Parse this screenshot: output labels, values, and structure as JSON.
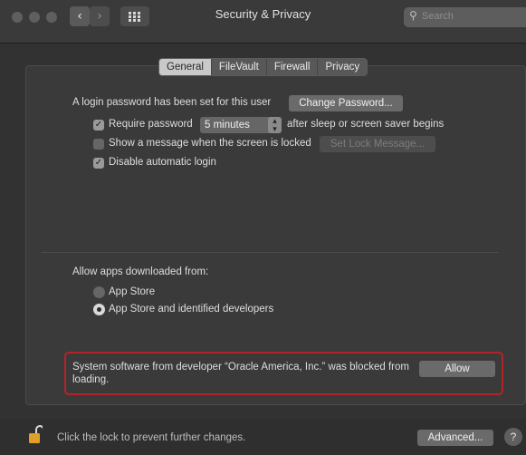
{
  "window": {
    "title": "Security & Privacy"
  },
  "toolbar": {
    "back_icon": "‹",
    "forward_icon": "›",
    "search_placeholder": "Search"
  },
  "tabs": [
    {
      "label": "General",
      "active": true
    },
    {
      "label": "FileVault",
      "active": false
    },
    {
      "label": "Firewall",
      "active": false
    },
    {
      "label": "Privacy",
      "active": false
    }
  ],
  "general": {
    "login_password_text": "A login password has been set for this user",
    "change_password_label": "Change Password...",
    "require_password": {
      "checked": true,
      "label": "Require password",
      "delay_value": "5 minutes",
      "suffix": "after sleep or screen saver begins"
    },
    "show_message": {
      "checked": false,
      "label": "Show a message when the screen is locked",
      "button_label": "Set Lock Message..."
    },
    "disable_auto_login": {
      "checked": true,
      "label": "Disable automatic login"
    }
  },
  "allow_apps": {
    "heading": "Allow apps downloaded from:",
    "options": [
      {
        "label": "App Store",
        "selected": false
      },
      {
        "label": "App Store and identified developers",
        "selected": true
      }
    ]
  },
  "alert": {
    "message": "System software from developer “Oracle America, Inc.” was blocked from loading.",
    "allow_label": "Allow",
    "highlight_color": "#b3232a"
  },
  "footer": {
    "lock_text": "Click the lock to prevent further changes.",
    "advanced_label": "Advanced...",
    "help_label": "?"
  }
}
